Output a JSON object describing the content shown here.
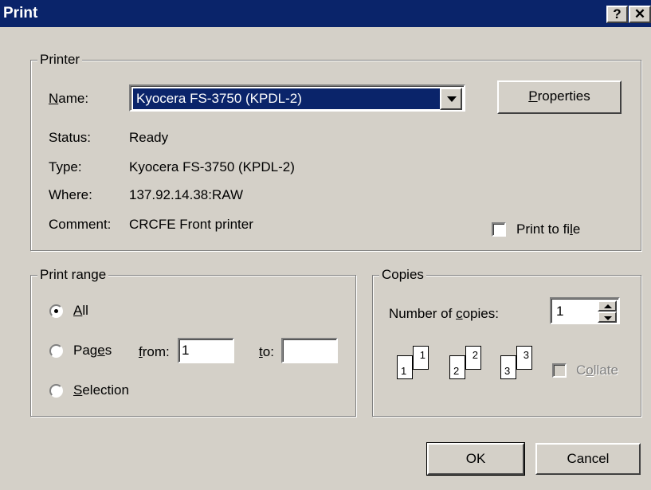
{
  "window": {
    "title": "Print",
    "help_glyph": "?",
    "close_glyph": "✕"
  },
  "printer": {
    "group_label": "Printer",
    "name_label": "Name:",
    "name_value": "Kyocera FS-3750 (KPDL-2)",
    "properties_label": "Properties",
    "status_label": "Status:",
    "status_value": "Ready",
    "type_label": "Type:",
    "type_value": "Kyocera FS-3750 (KPDL-2)",
    "where_label": "Where:",
    "where_value": "137.92.14.38:RAW",
    "comment_label": "Comment:",
    "comment_value": "CRCFE Front printer",
    "print_to_file_label": "Print to file",
    "print_to_file_checked": false
  },
  "range": {
    "group_label": "Print range",
    "all_label": "All",
    "pages_label": "Pages",
    "from_label": "from:",
    "from_value": "1",
    "to_label": "to:",
    "to_value": "",
    "selection_label": "Selection",
    "selected": "all"
  },
  "copies": {
    "group_label": "Copies",
    "number_label": "Number of copies:",
    "number_value": "1",
    "collate_label": "Collate",
    "collate_checked": false,
    "collate_enabled": false,
    "pages": [
      "1",
      "1",
      "2",
      "2",
      "3",
      "3"
    ]
  },
  "buttons": {
    "ok": "OK",
    "cancel": "Cancel"
  }
}
